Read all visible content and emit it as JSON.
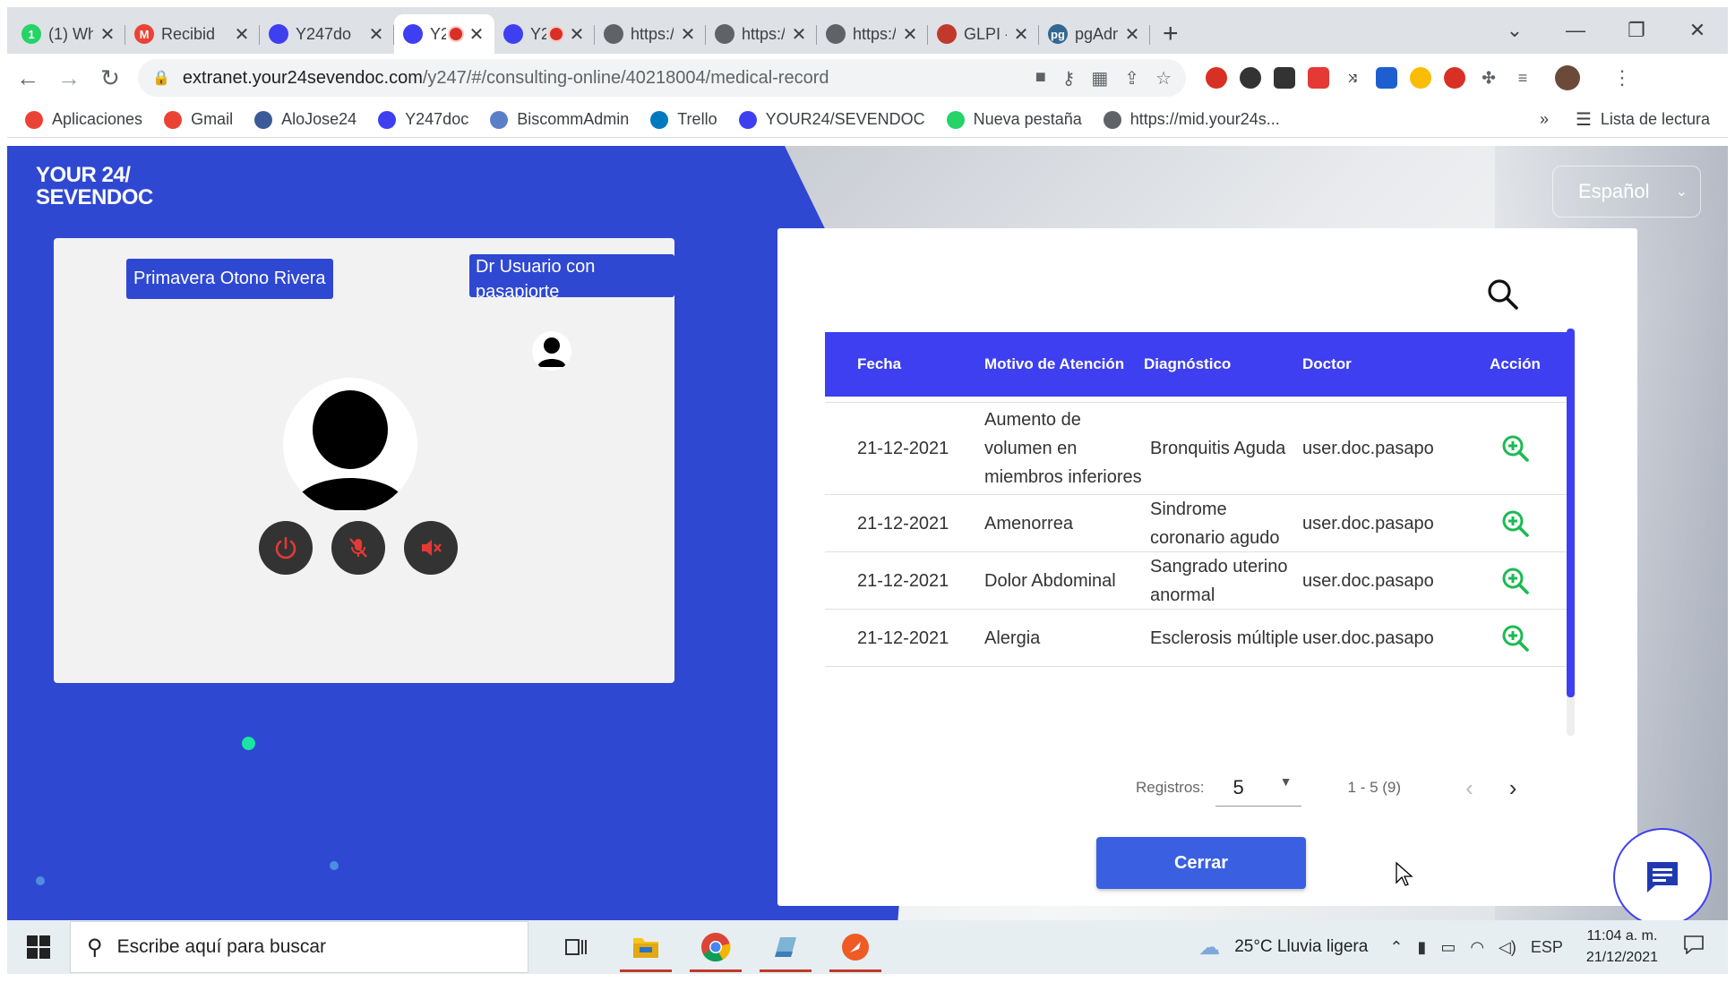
{
  "browser": {
    "tabs": [
      {
        "title": "(1) Wh",
        "favicon_color": "#25d366",
        "favicon_glyph": "1",
        "active": false,
        "recording": false
      },
      {
        "title": "Recibid",
        "favicon_color": "#ea4335",
        "favicon_glyph": "M",
        "active": false,
        "recording": false
      },
      {
        "title": "Y247do",
        "favicon_color": "#3e3ff0",
        "favicon_glyph": "",
        "active": false,
        "recording": false
      },
      {
        "title": "Y2",
        "favicon_color": "#3e3ff0",
        "favicon_glyph": "",
        "active": true,
        "recording": true
      },
      {
        "title": "Y2",
        "favicon_color": "#3e3ff0",
        "favicon_glyph": "",
        "active": false,
        "recording": true
      },
      {
        "title": "https://",
        "favicon_color": "#5f6368",
        "favicon_glyph": "",
        "active": false,
        "recording": false
      },
      {
        "title": "https://",
        "favicon_color": "#5f6368",
        "favicon_glyph": "",
        "active": false,
        "recording": false
      },
      {
        "title": "https://",
        "favicon_color": "#5f6368",
        "favicon_glyph": "",
        "active": false,
        "recording": false
      },
      {
        "title": "GLPI -",
        "favicon_color": "#c0392b",
        "favicon_glyph": "",
        "active": false,
        "recording": false
      },
      {
        "title": "pgAdm",
        "favicon_color": "#336791",
        "favicon_glyph": "pg",
        "active": false,
        "recording": false
      }
    ],
    "new_tab_glyph": "+",
    "url_host": "extranet.your24sevendoc.com",
    "url_path": "/y247/#/consulting-online/40218004/medical-record",
    "bookmarks": [
      {
        "label": "Aplicaciones",
        "color": "#ea4335"
      },
      {
        "label": "Gmail",
        "color": "#ea4335"
      },
      {
        "label": "AloJose24",
        "color": "#3c5a99"
      },
      {
        "label": "Y247doc",
        "color": "#3e3ff0"
      },
      {
        "label": "BiscommAdmin",
        "color": "#5b7fc7"
      },
      {
        "label": "Trello",
        "color": "#0079bf"
      },
      {
        "label": "YOUR24/SEVENDOC",
        "color": "#3e3ff0"
      },
      {
        "label": "Nueva pestaña",
        "color": "#25d366"
      },
      {
        "label": "https://mid.your24s...",
        "color": "#5f6368"
      }
    ],
    "bookmarks_more": "»",
    "reading_list": "Lista de lectura"
  },
  "brand": {
    "line1": "YOUR 24/",
    "line2": "SEVENDOC"
  },
  "language_select": {
    "value": "Español"
  },
  "video": {
    "patient_name": "Primavera Otono Rivera",
    "doctor_name": "Dr Usuario con pasapiorte"
  },
  "record_table": {
    "headers": {
      "fecha": "Fecha",
      "motivo": "Motivo de Atención",
      "diagnostico": "Diagnóstico",
      "doctor": "Doctor",
      "accion": "Acción"
    },
    "rows": [
      {
        "fecha": "21-12-2021",
        "motivo": "Aumento de volumen en miembros inferiores",
        "diagnostico": "Bronquitis Aguda",
        "doctor": "user.doc.pasapo"
      },
      {
        "fecha": "21-12-2021",
        "motivo": "Amenorrea",
        "diagnostico": "Sindrome coronario agudo",
        "doctor": "user.doc.pasapo"
      },
      {
        "fecha": "21-12-2021",
        "motivo": "Dolor Abdominal",
        "diagnostico": "Sangrado uterino anormal",
        "doctor": "user.doc.pasapo"
      },
      {
        "fecha": "21-12-2021",
        "motivo": "Alergia",
        "diagnostico": "Esclerosis múltiple",
        "doctor": "user.doc.pasapo"
      }
    ],
    "accent_color": "#3e3ff0",
    "action_icon_color": "#1db954"
  },
  "pager": {
    "label": "Registros:",
    "page_size": "5",
    "range": "1 - 5 (9)"
  },
  "close_button": "Cerrar",
  "taskbar": {
    "search_placeholder": "Escribe aquí para buscar",
    "weather": "25°C  Lluvia ligera",
    "lang": "ESP",
    "time": "11:04 a. m.",
    "date": "21/12/2021"
  }
}
